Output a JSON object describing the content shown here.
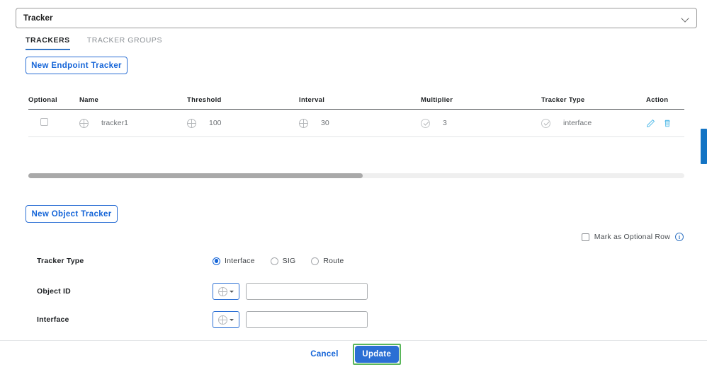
{
  "top_select": {
    "value": "Tracker",
    "chevron_icon": "chevron-down-icon"
  },
  "tabs": [
    {
      "label": "TRACKERS",
      "active": true
    },
    {
      "label": "TRACKER GROUPS",
      "active": false
    }
  ],
  "buttons": {
    "new_endpoint_tracker": "New Endpoint Tracker",
    "new_object_tracker": "New Object Tracker"
  },
  "table": {
    "headers": [
      "Optional",
      "Name",
      "Threshold",
      "Interval",
      "Multiplier",
      "Tracker Type",
      "Action"
    ],
    "rows": [
      {
        "optional": "",
        "name": "tracker1",
        "name_icon": "globe-icon",
        "threshold": "100",
        "threshold_icon": "globe-icon",
        "interval": "30",
        "interval_icon": "globe-icon",
        "multiplier": "3",
        "multiplier_icon": "check-circle-icon",
        "tracker_type": "interface",
        "tracker_type_icon": "check-circle-icon",
        "edit_icon": "pencil-icon",
        "delete_icon": "trash-icon"
      }
    ]
  },
  "optional_row": {
    "label": "Mark as Optional Row",
    "checked": false,
    "info_icon": "info-icon",
    "info_char": "i"
  },
  "form": {
    "tracker_type": {
      "label": "Tracker Type",
      "options": [
        "Interface",
        "SIG",
        "Route"
      ],
      "selected": "Interface"
    },
    "object_id": {
      "label": "Object ID",
      "scope_icon": "globe-icon",
      "value": "",
      "placeholder": ""
    },
    "interface": {
      "label": "Interface",
      "scope_icon": "globe-icon",
      "value": "",
      "placeholder": ""
    }
  },
  "footer": {
    "cancel_label": "Cancel",
    "update_label": "Update"
  },
  "colors": {
    "accent_blue": "#2b6fd4",
    "link_blue": "#1565d8",
    "icon_blue": "#4db8e8",
    "highlight_green": "#5bb75b",
    "scrollbar_blue": "#1474c4"
  }
}
